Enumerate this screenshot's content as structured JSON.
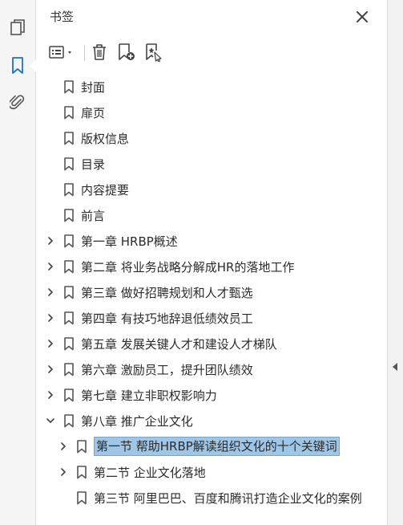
{
  "panel": {
    "title": "书签"
  },
  "rail": {
    "icons": [
      "pages-icon",
      "bookmarks-icon",
      "attachments-icon"
    ],
    "active_color": "#1a73c8"
  },
  "toolbar": {
    "buttons": [
      "options-menu-icon",
      "trash-icon",
      "new-bookmark-icon",
      "new-bookmark-from-structure-icon"
    ]
  },
  "bookmarks": [
    {
      "label": "封面",
      "level": 0,
      "expandable": false
    },
    {
      "label": "扉页",
      "level": 0,
      "expandable": false
    },
    {
      "label": "版权信息",
      "level": 0,
      "expandable": false
    },
    {
      "label": "目录",
      "level": 0,
      "expandable": false
    },
    {
      "label": "内容提要",
      "level": 0,
      "expandable": false
    },
    {
      "label": "前言",
      "level": 0,
      "expandable": false
    },
    {
      "label": "第一章 HRBP概述",
      "level": 0,
      "expandable": true,
      "expanded": false
    },
    {
      "label": "第二章 将业务战略分解成HR的落地工作",
      "level": 0,
      "expandable": true,
      "expanded": false
    },
    {
      "label": "第三章 做好招聘规划和人才甄选",
      "level": 0,
      "expandable": true,
      "expanded": false
    },
    {
      "label": "第四章 有技巧地辞退低绩效员工",
      "level": 0,
      "expandable": true,
      "expanded": false
    },
    {
      "label": "第五章 发展关键人才和建设人才梯队",
      "level": 0,
      "expandable": true,
      "expanded": false
    },
    {
      "label": "第六章 激励员工，提升团队绩效",
      "level": 0,
      "expandable": true,
      "expanded": false
    },
    {
      "label": "第七章 建立非职权影响力",
      "level": 0,
      "expandable": true,
      "expanded": false
    },
    {
      "label": "第八章 推广企业文化",
      "level": 0,
      "expandable": true,
      "expanded": true
    },
    {
      "label": "第一节 帮助HRBP解读组织文化的十个关键词",
      "level": 1,
      "expandable": true,
      "expanded": false,
      "selected": true
    },
    {
      "label": "第二节 企业文化落地",
      "level": 1,
      "expandable": true,
      "expanded": false
    },
    {
      "label": "第三节 阿里巴巴、百度和腾讯打造企业文化的案例",
      "level": 1,
      "expandable": false
    }
  ]
}
